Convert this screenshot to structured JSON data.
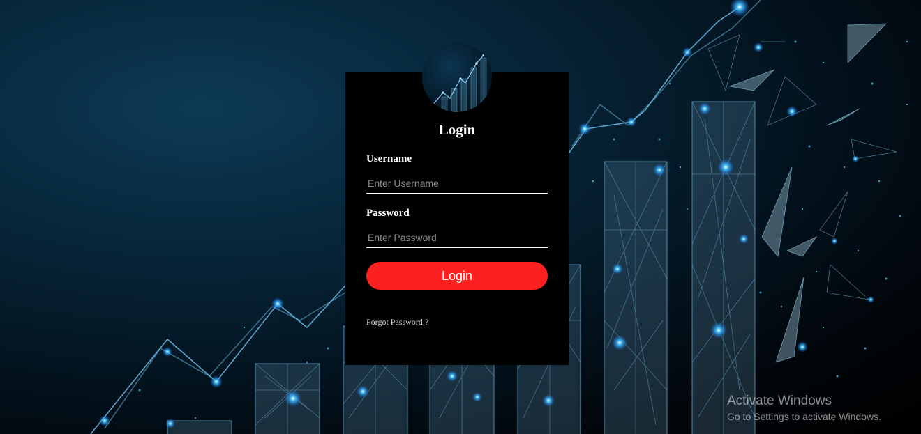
{
  "login_card": {
    "title": "Login",
    "username": {
      "label": "Username",
      "placeholder": "Enter Username",
      "value": ""
    },
    "password": {
      "label": "Password",
      "placeholder": "Enter Password",
      "value": ""
    },
    "submit_label": "Login",
    "forgot_password_label": "Forgot Password ?"
  },
  "watermark": {
    "title": "Activate Windows",
    "subtitle": "Go to Settings to activate Windows."
  },
  "colors": {
    "card_background": "#000000",
    "login_button": "#fb2121",
    "background_dark": "#031420",
    "network_glow": "#2fb8ff"
  },
  "icons": {
    "avatar": "growth-chart-network-icon"
  }
}
